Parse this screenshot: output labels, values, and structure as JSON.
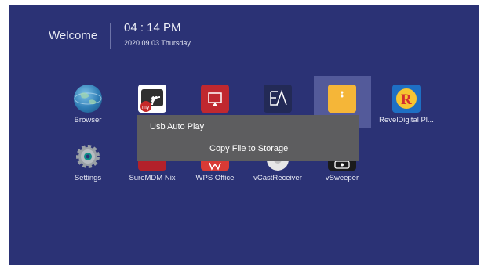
{
  "header": {
    "welcome": "Welcome",
    "time": "04 : 14 PM",
    "date": "2020.09.03 Thursday"
  },
  "apps": [
    {
      "label": "Browser",
      "icon": "globe-icon"
    },
    {
      "label": "",
      "icon": "mycast-icon"
    },
    {
      "label": "",
      "icon": "screen-mirror-icon"
    },
    {
      "label": "",
      "icon": "ea-icon"
    },
    {
      "label": "",
      "icon": "file-folder-icon"
    },
    {
      "label": "RevelDigital Pl...",
      "icon": "revel-digital-icon"
    },
    {
      "label": "Settings",
      "icon": "gear-icon"
    },
    {
      "label": "SureMDM Nix",
      "icon": "suremdm-icon"
    },
    {
      "label": "WPS Office",
      "icon": "wps-office-icon"
    },
    {
      "label": "vCastReceiver",
      "icon": "vcast-icon"
    },
    {
      "label": "vSweeper",
      "icon": "vsweeper-icon"
    }
  ],
  "dialog": {
    "option1": "Usb Auto Play",
    "option2": "Copy File to Storage"
  },
  "colors": {
    "background": "#2b3275",
    "selection": "#535a9a",
    "dialog": "#5d5d5f"
  }
}
